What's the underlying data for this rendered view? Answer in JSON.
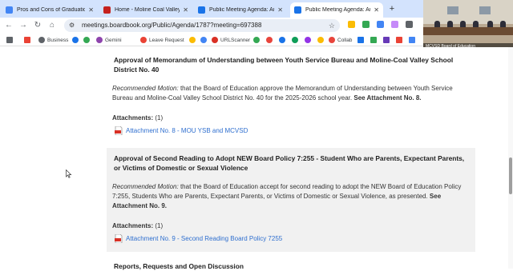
{
  "browser": {
    "tabs": [
      {
        "title": "Pros and Cons of Graduation",
        "active": false,
        "favicon_color": "#4285f4"
      },
      {
        "title": "Home - Moline Coal Valley Scho",
        "active": false,
        "favicon_color": "#c5221f"
      },
      {
        "title": "Public Meeting Agenda: Augus",
        "active": false,
        "favicon_color": "#1a73e8"
      },
      {
        "title": "Public Meeting Agenda: Augus",
        "active": true,
        "favicon_color": "#1a73e8"
      }
    ],
    "new_tab_label": "+",
    "url": "meetings.boardbook.org/Public/Agenda/1787?meeting=697388",
    "bookmarks": [
      {
        "label": "Business",
        "color": "#5f6368"
      },
      {
        "label": "Gemini",
        "color": "#8e44ad"
      },
      {
        "label": "Leave Request",
        "color": "#ea4335"
      },
      {
        "label": "URLScanner",
        "color": "#d93025"
      },
      {
        "label": "Collab",
        "color": "#e8453c"
      }
    ],
    "video_caption": "MCVSD Board of Education"
  },
  "agenda": {
    "item1": {
      "title": "Approval of Memorandum of Understanding between Youth Service Bureau and Moline-Coal Valley School District No. 40",
      "motion_label": "Recommended Motion:",
      "motion_text": " that the Board of Education approve the Memorandum of Understanding between Youth Service Bureau and Moline-Coal Valley School District No. 40 for the 2025-2026 school year. ",
      "see_text": "See Attachment No. 8.",
      "attachments_label": "Attachments:",
      "attachments_count": " (1)",
      "attachment_link": "Attachment No. 8 - MOU YSB and MCVSD"
    },
    "item2": {
      "title": "Approval of Second Reading to Adopt NEW Board Policy 7:255 - Student Who are Parents, Expectant Parents, or Victims of Domestic or Sexual Violence",
      "motion_label": "Recommended Motion:",
      "motion_text": " that the Board of Education accept for second reading to adopt the NEW Board of Education Policy 7:255, Students Who are Parents, Expectant Parents, or Victims of Domestic or Sexual Violence, as presented. ",
      "see_text": "See Attachment No. 9.",
      "attachments_label": "Attachments:",
      "attachments_count": " (1)",
      "attachment_link": "Attachment No. 9 - Second Reading Board Policy 7255"
    },
    "item3": {
      "title": "Reports, Requests and Open Discussion"
    }
  },
  "colors": {
    "link": "#2f6fcf",
    "shaded_section": "#f1f1f1",
    "tab_strip": "#d3e3fd",
    "pdf_red": "#d93025"
  }
}
